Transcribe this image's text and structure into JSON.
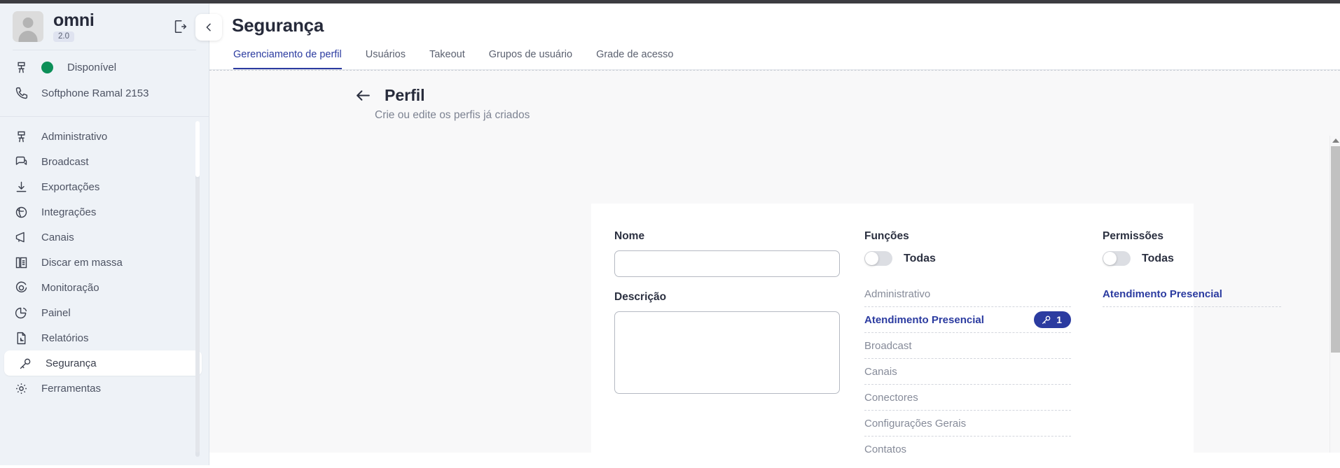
{
  "sidebar": {
    "account_name": "omni",
    "version_badge": "2.0",
    "logout_icon": "logout-icon",
    "status": {
      "label": "Disponível",
      "icon": "desk-icon",
      "dot_color": "#0c8f58"
    },
    "phone": {
      "label": "Softphone Ramal 2153",
      "icon": "phone-icon"
    },
    "items": [
      {
        "label": "Administrativo",
        "icon": "desk-icon",
        "active": false
      },
      {
        "label": "Broadcast",
        "icon": "chat-icon",
        "active": false
      },
      {
        "label": "Exportações",
        "icon": "download-icon",
        "active": false
      },
      {
        "label": "Integrações",
        "icon": "globe-icon",
        "active": false
      },
      {
        "label": "Canais",
        "icon": "megaphone-icon",
        "active": false
      },
      {
        "label": "Discar em massa",
        "icon": "dialer-icon",
        "active": false
      },
      {
        "label": "Monitoração",
        "icon": "target-icon",
        "active": false
      },
      {
        "label": "Painel",
        "icon": "pie-chart-icon",
        "active": false
      },
      {
        "label": "Relatórios",
        "icon": "report-icon",
        "active": false
      },
      {
        "label": "Segurança",
        "icon": "key-icon",
        "active": true
      },
      {
        "label": "Ferramentas",
        "icon": "gear-icon",
        "active": false
      }
    ],
    "collapse_icon": "chevron-left-icon"
  },
  "header": {
    "title": "Segurança",
    "tabs": [
      {
        "label": "Gerenciamento de perfil",
        "active": true
      },
      {
        "label": "Usuários",
        "active": false
      },
      {
        "label": "Takeout",
        "active": false
      },
      {
        "label": "Grupos de usuário",
        "active": false
      },
      {
        "label": "Grade de acesso",
        "active": false
      }
    ]
  },
  "panel": {
    "back_icon": "arrow-left-icon",
    "title": "Perfil",
    "subtitle": "Crie ou edite os perfis já criados"
  },
  "form": {
    "name_label": "Nome",
    "name_value": "",
    "name_placeholder": "",
    "description_label": "Descrição",
    "description_value": "",
    "description_placeholder": ""
  },
  "functions": {
    "heading": "Funções",
    "toggle_label": "Todas",
    "toggle_on": false,
    "items": [
      {
        "label": "Administrativo",
        "selected": false,
        "badge": null
      },
      {
        "label": "Atendimento Presencial",
        "selected": true,
        "badge": "1",
        "badge_icon": "key-icon"
      },
      {
        "label": "Broadcast",
        "selected": false,
        "badge": null
      },
      {
        "label": "Canais",
        "selected": false,
        "badge": null
      },
      {
        "label": "Conectores",
        "selected": false,
        "badge": null
      },
      {
        "label": "Configurações Gerais",
        "selected": false,
        "badge": null
      },
      {
        "label": "Contatos",
        "selected": false,
        "badge": null
      }
    ]
  },
  "permissions": {
    "heading": "Permissões",
    "toggle_label": "Todas",
    "toggle_on": false,
    "items": [
      {
        "label": "Atendimento Presencial",
        "selected": true
      }
    ]
  },
  "colors": {
    "accent": "#2b3ba0",
    "sidebar_bg": "#eef2f7",
    "status_green": "#0c8f58",
    "content_bg": "#f8f8f9"
  }
}
